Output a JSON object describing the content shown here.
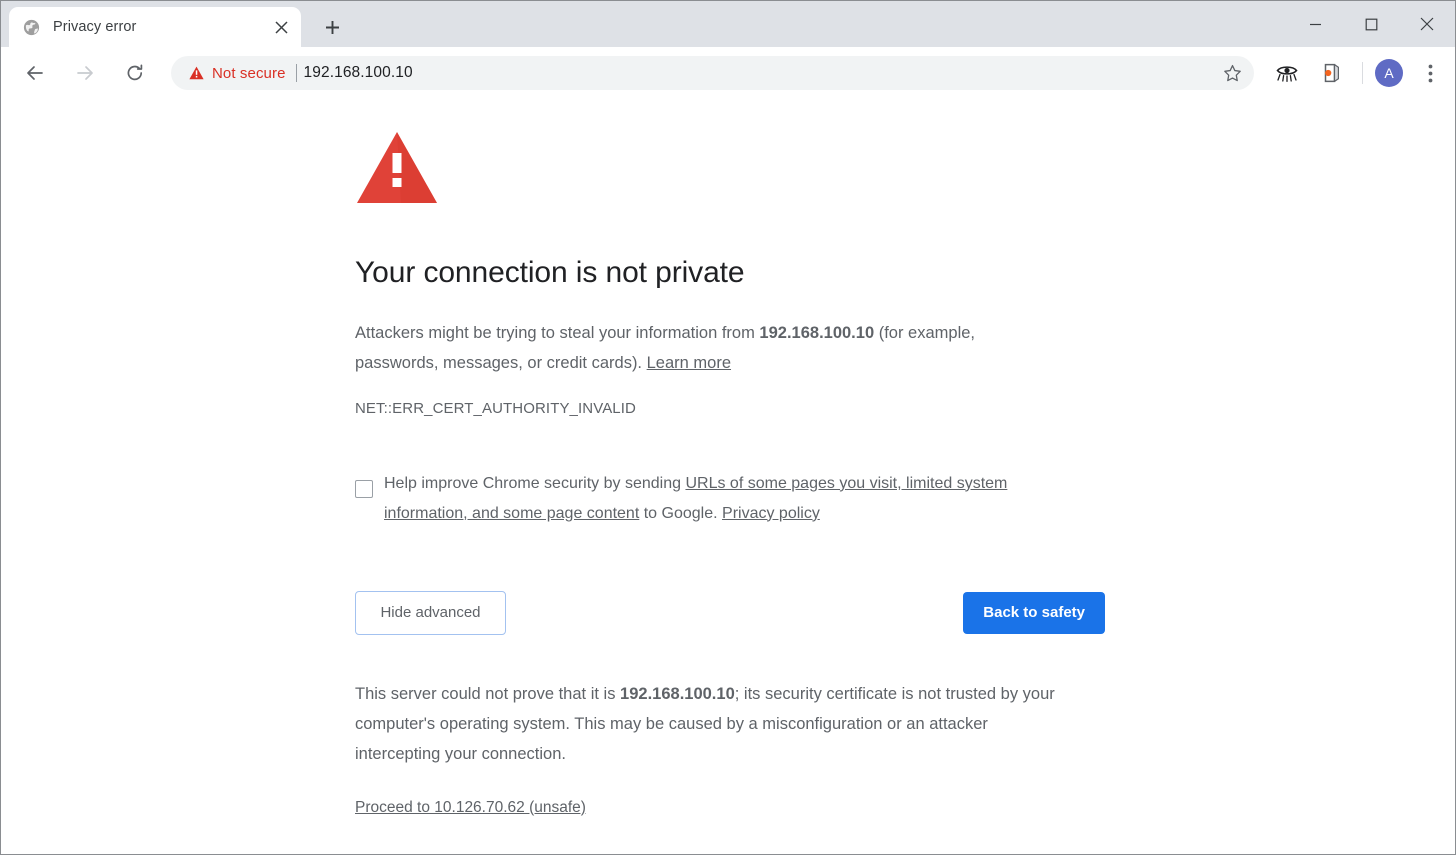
{
  "window": {
    "controls": {
      "minimize_label": "Minimize",
      "maximize_label": "Maximize",
      "close_label": "Close"
    }
  },
  "tabstrip": {
    "tabs": [
      {
        "title": "Privacy error",
        "favicon": "globe-icon",
        "close_label": "Close tab",
        "active": true
      }
    ],
    "new_tab_label": "New tab"
  },
  "toolbar": {
    "back_label": "Back",
    "forward_label": "Forward",
    "reload_label": "Reload",
    "omnibox": {
      "security_icon": "warning-triangle-icon",
      "security_text": "Not secure",
      "url": "192.168.100.10",
      "bookmark_icon": "star-icon"
    },
    "extensions": [
      {
        "icon": "eye-extension-icon",
        "name": "eye-extension"
      },
      {
        "icon": "orange-dot-extension-icon",
        "name": "orange-dot-extension"
      }
    ],
    "profile": {
      "avatar_initial": "A",
      "avatar_color": "#5f6bc4"
    },
    "menu_icon": "three-dot-menu-icon"
  },
  "interstitial": {
    "icon": "red-warning-triangle-icon",
    "heading": "Your connection is not private",
    "body": {
      "part1": "Attackers might be trying to steal your information from",
      "host": "192.168.100.10",
      "part2": "(for example, passwords, messages, or credit cards).",
      "learn_more": "Learn more"
    },
    "error_code": "NET::ERR_CERT_AUTHORITY_INVALID",
    "optin": {
      "checked": false,
      "part1": "Help improve Chrome security by sending",
      "link1": "URLs of some pages you visit, limited system information, and some page content",
      "part2": "to Google.",
      "link2": "Privacy policy"
    },
    "buttons": {
      "advanced_toggle": "Hide advanced",
      "back_to_safety": "Back to safety",
      "primary_color": "#1a73e8"
    },
    "advanced": {
      "part1": "This server could not prove that it is",
      "host": "192.168.100.10",
      "part2": "; its security certificate is not trusted by your computer's operating system. This may be caused by a misconfiguration or an attacker intercepting your connection.",
      "proceed_link": "Proceed to 10.126.70.62 (unsafe)"
    }
  }
}
